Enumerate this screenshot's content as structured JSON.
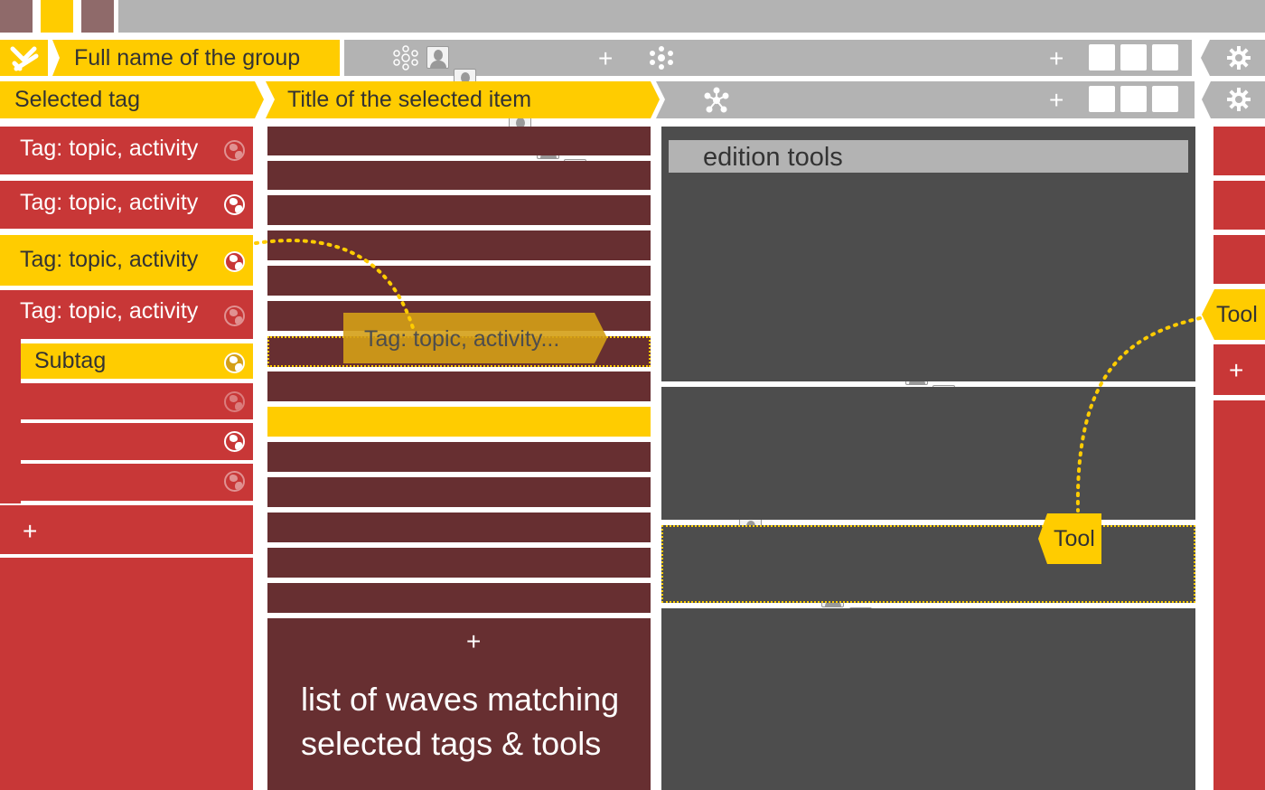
{
  "header": {
    "group_name": "Full name of the group",
    "selected_tag": "Selected tag",
    "selected_item_title": "Title of the selected item",
    "plus": "+"
  },
  "tags": {
    "items": [
      {
        "label": "Tag: topic, activity",
        "state": "normal"
      },
      {
        "label": "Tag: topic, activity",
        "state": "normal"
      },
      {
        "label": "Tag: topic, activity",
        "state": "selected"
      },
      {
        "label": "Tag: topic, activity",
        "state": "normal"
      }
    ],
    "subtag_label": "Subtag",
    "add_label": "+"
  },
  "waves": {
    "drag_label": "Tag: topic, activity...",
    "add_label": "+",
    "footer_text_line1": "list of waves matching",
    "footer_text_line2": "selected tags & tools"
  },
  "editor": {
    "title": "edition tools",
    "tool_drop_label": "Tool"
  },
  "tools": {
    "drag_label": "Tool",
    "add_label": "+"
  },
  "colors": {
    "accent_yellow": "#ffcc00",
    "tag_red": "#c83737",
    "wave_maroon": "#672f31",
    "editor_dark": "#4d4d4d",
    "chrome_gray": "#b3b3b3"
  },
  "icons": {
    "logo": "wave-logo-icon",
    "participants": "participants-icon",
    "network": "network-icon",
    "globe": "globe-icon",
    "settings": "gear-icon",
    "avatar": "avatar-icon"
  }
}
